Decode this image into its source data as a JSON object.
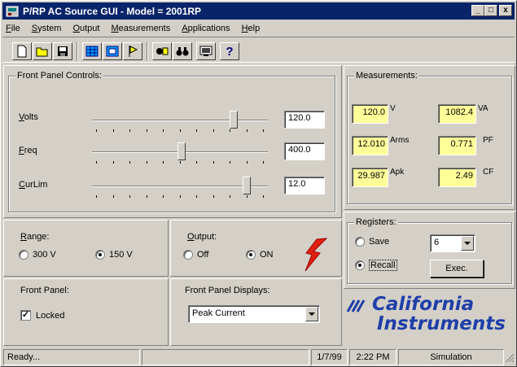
{
  "window": {
    "title": "P/RP AC Source GUI - Model = 2001RP",
    "min": "_",
    "max": "□",
    "close": "x"
  },
  "menu": [
    "File",
    "System",
    "Output",
    "Measurements",
    "Applications",
    "Help"
  ],
  "toolbar": {
    "icons": [
      "new-file-icon",
      "open-folder-icon",
      "save-disk-icon",
      "grid-icon",
      "window-icon",
      "flag-icon",
      "tape-icon",
      "binoculars-icon",
      "monitor-icon",
      "help-icon"
    ]
  },
  "front_panel": {
    "title": "Front Panel Controls:",
    "controls": [
      {
        "label": "Volts",
        "value": "120.0",
        "level": 0.7
      },
      {
        "label": "Freq",
        "value": "400.0",
        "level": 0.48
      },
      {
        "label": "CurLim",
        "value": "12.0",
        "level": 0.82
      }
    ]
  },
  "measurements": {
    "title": "Measurements:",
    "items": [
      {
        "value": "120.0",
        "unit": "V"
      },
      {
        "value": "1082.4",
        "unit": "VA"
      },
      {
        "value": "12.010",
        "unit": "Arms"
      },
      {
        "value": "0.771",
        "unit": "PF"
      },
      {
        "value": "29.987",
        "unit": "Apk"
      },
      {
        "value": "2.49",
        "unit": "CF"
      }
    ]
  },
  "range": {
    "title": "Range:",
    "opt1": "300 V",
    "opt2": "150 V",
    "selected": "150 V"
  },
  "output": {
    "title": "Output:",
    "opt1": "Off",
    "opt2": "ON",
    "selected": "ON"
  },
  "registers": {
    "title": "Registers:",
    "save": "Save",
    "recall": "Recall",
    "selected": "Recall",
    "number": "6",
    "exec": "Exec."
  },
  "front_panel_lock": {
    "title": "Front Panel:",
    "locked_label": "Locked",
    "checked": true
  },
  "displays": {
    "title": "Front Panel Displays:",
    "selected": "Peak Current"
  },
  "logo": {
    "line1": "California",
    "line2": "Instruments",
    "color": "#1f3fa8"
  },
  "status": {
    "text": "Ready...",
    "date": "1/7/99",
    "time": "2:22 PM",
    "mode": "Simulation"
  },
  "colors": {
    "title_bar": "#0a246a",
    "measurement_bg": "#ffff99",
    "bolt": "#e02010"
  }
}
